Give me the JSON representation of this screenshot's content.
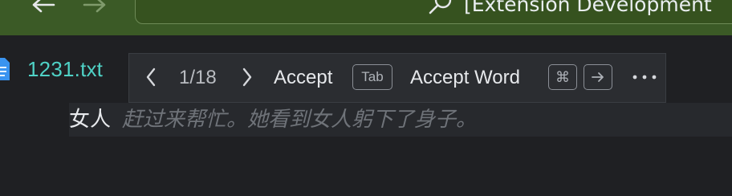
{
  "titlebar": {
    "back_icon": "arrow-left-icon",
    "forward_icon": "arrow-right-icon",
    "search_icon": "search-icon",
    "title": "[Extension Development"
  },
  "editor": {
    "tab": {
      "icon": "file-icon",
      "label": "1231.txt"
    },
    "inline_suggestion_toolbar": {
      "prev_icon": "chevron-left-icon",
      "counter": "1/18",
      "next_icon": "chevron-right-icon",
      "accept_label": "Accept",
      "accept_key": "Tab",
      "accept_word_label": "Accept Word",
      "cmd_key": "⌘",
      "arrow_key_icon": "arrow-right-key-icon",
      "more_icon": "more-icon"
    },
    "line": {
      "typed_text": "女人",
      "ghost_suggestion": "赶过来帮忙。她看到女人躬下了身子。"
    }
  },
  "colors": {
    "titlebar_bg": "#3b5a26",
    "editor_bg": "#1f2023",
    "tab_label": "#4fd2c6",
    "ghost_text": "#6f7379"
  }
}
